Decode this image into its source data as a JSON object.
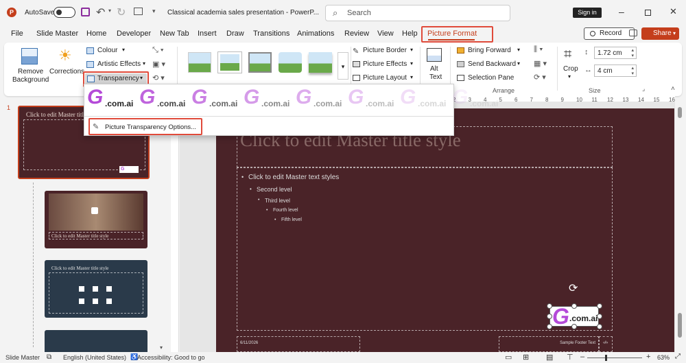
{
  "titlebar": {
    "autosave_label": "AutoSave",
    "document_title": "Classical academia sales presentation  -  PowerP...",
    "search_placeholder": "Search",
    "signin_label": "Sign in"
  },
  "menu_tabs": [
    "File",
    "Slide Master",
    "Home",
    "Developer",
    "New Tab",
    "Insert",
    "Draw",
    "Transitions",
    "Animations",
    "Review",
    "View",
    "Help",
    "Picture Format"
  ],
  "record_label": "Record",
  "share_label": "Share",
  "ribbon": {
    "remove_background": [
      "Remove",
      "Background"
    ],
    "corrections": "Corrections",
    "colour": "Colour",
    "artistic_effects": "Artistic Effects",
    "transparency": "Transparency",
    "picture_border": "Picture Border",
    "picture_effects": "Picture Effects",
    "picture_layout": "Picture Layout",
    "alt_text": [
      "Alt",
      "Text"
    ],
    "bring_forward": "Bring Forward",
    "send_backward": "Send Backward",
    "selection_pane": "Selection Pane",
    "arrange_label": "Arrange",
    "crop": "Crop",
    "height": "1.72 cm",
    "width": "4 cm",
    "size_label": "Size"
  },
  "dropdown": {
    "preset_text": ".com.ai",
    "preset_letter": "G",
    "options_label": "Picture Transparency Options..."
  },
  "thumbs": {
    "slide_number": "1",
    "thumb1_title": "Click to edit Master title style",
    "thumb2_title": "Click to edit Master title style",
    "thumb3_title": "Click to edit Master title style"
  },
  "slide": {
    "title": "Click to edit Master title style",
    "level1": "Click to edit Master text styles",
    "level2": "Second level",
    "level3": "Third level",
    "level4": "Fourth level",
    "level5": "Fifth level",
    "date": "6/11/2026",
    "footer": "Sample Footer Text",
    "page": "‹#›",
    "logo_letter": "G",
    "logo_text": ".com.ai"
  },
  "ruler_numbers": [
    "2",
    "3",
    "4",
    "5",
    "6",
    "7",
    "8",
    "9",
    "10",
    "11",
    "12",
    "13",
    "14",
    "15",
    "16"
  ],
  "status": {
    "mode": "Slide Master",
    "language": "English (United States)",
    "accessibility": "Accessibility: Good to go",
    "zoom": "63%"
  },
  "colors": {
    "accent": "#c43e1c",
    "slide_bg": "#4a2328",
    "highlight": "#e04a3a",
    "logo_gradient_start": "#b44ad8",
    "logo_gradient_end": "#e0338f"
  }
}
